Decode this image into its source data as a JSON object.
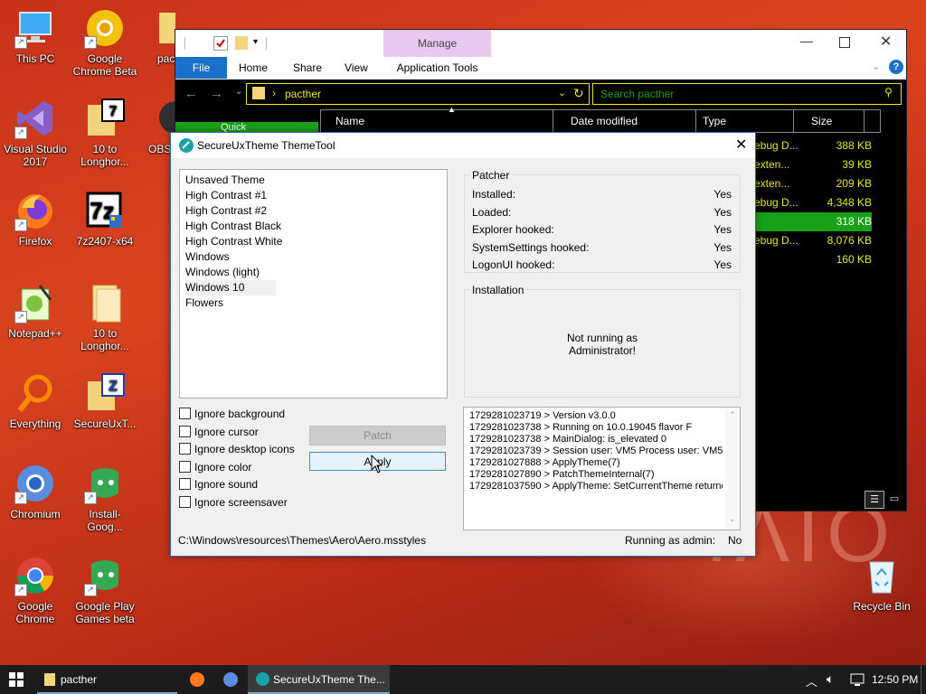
{
  "desktop": {
    "icons": [
      {
        "label": "This PC"
      },
      {
        "label": "Google Chrome Beta"
      },
      {
        "label": "pac"
      },
      {
        "label": "Visual Studio 2017"
      },
      {
        "label": "10 to Longhor..."
      },
      {
        "label": "OBS"
      },
      {
        "label": "Firefox"
      },
      {
        "label": "7z2407-x64"
      },
      {
        "label": "Notepad++"
      },
      {
        "label": "10 to Longhor..."
      },
      {
        "label": "Everything"
      },
      {
        "label": "SecureUxT..."
      },
      {
        "label": "Chromium"
      },
      {
        "label": "Install-Goog..."
      },
      {
        "label": "Google Chrome"
      },
      {
        "label": "Google Play Games beta"
      },
      {
        "label": "Recycle Bin"
      }
    ]
  },
  "explorer": {
    "manage_tab": "Manage",
    "ribbon_tabs": [
      "File",
      "Home",
      "Share",
      "View",
      "Application Tools"
    ],
    "address_path": "pacther",
    "search_placeholder": "Search pacther",
    "columns": [
      "Name",
      "Date modified",
      "Type",
      "Size"
    ],
    "rows": [
      {
        "type": "ebug D...",
        "size": "388 KB"
      },
      {
        "type": "exten...",
        "size": "39 KB"
      },
      {
        "type": "exten...",
        "size": "209 KB"
      },
      {
        "type": "ebug D...",
        "size": "4,348 KB"
      },
      {
        "type": "",
        "size": "318 KB"
      },
      {
        "type": "ebug D...",
        "size": "8,076 KB"
      },
      {
        "type": "",
        "size": "160 KB"
      }
    ],
    "quick_access_partial": "Quick"
  },
  "dialog": {
    "title": "SecureUxTheme ThemeTool",
    "themes": [
      "Unsaved Theme",
      "High Contrast #1",
      "High Contrast #2",
      "High Contrast Black",
      "High Contrast White",
      "Windows",
      "Windows (light)",
      "Windows 10",
      "Flowers"
    ],
    "patcher": {
      "label": "Patcher",
      "rows": [
        {
          "key": "Installed:",
          "value": "Yes"
        },
        {
          "key": "Loaded:",
          "value": "Yes"
        },
        {
          "key": "Explorer hooked:",
          "value": "Yes"
        },
        {
          "key": "SystemSettings hooked:",
          "value": "Yes"
        },
        {
          "key": "LogonUI hooked:",
          "value": "Yes"
        }
      ]
    },
    "installation": {
      "label": "Installation",
      "message_line1": "Not running as",
      "message_line2": "Administrator!"
    },
    "options": [
      "Ignore background",
      "Ignore cursor",
      "Ignore desktop icons",
      "Ignore color",
      "Ignore sound",
      "Ignore screensaver"
    ],
    "patch_button": "Patch",
    "apply_button": "Apply",
    "log": [
      "1729281023719 > Version v3.0.0",
      "1729281023738 > Running on 10.0.19045 flavor F",
      "1729281023738 > MainDialog: is_elevated 0",
      "1729281023739 > Session user: VM5 Process user: VM5",
      "1729281027888 > ApplyTheme(7)",
      "1729281027890 > PatchThemeInternal(7)",
      "1729281037590 > ApplyTheme: SetCurrentTheme returne"
    ],
    "path": "C:\\Windows\\resources\\Themes\\Aero\\Aero.msstyles",
    "admin_label": "Running as admin:",
    "admin_value": "No"
  },
  "taskbar": {
    "items": [
      "pacther",
      "SecureUxTheme The..."
    ],
    "time": "12:50 PM"
  },
  "colors": {
    "accent": "#0063b1",
    "manage_tab": "#e8c8f0",
    "explorer_text": "#e8e800",
    "selection_green": "#19a019",
    "dialog_border": "#2b6bb5"
  }
}
